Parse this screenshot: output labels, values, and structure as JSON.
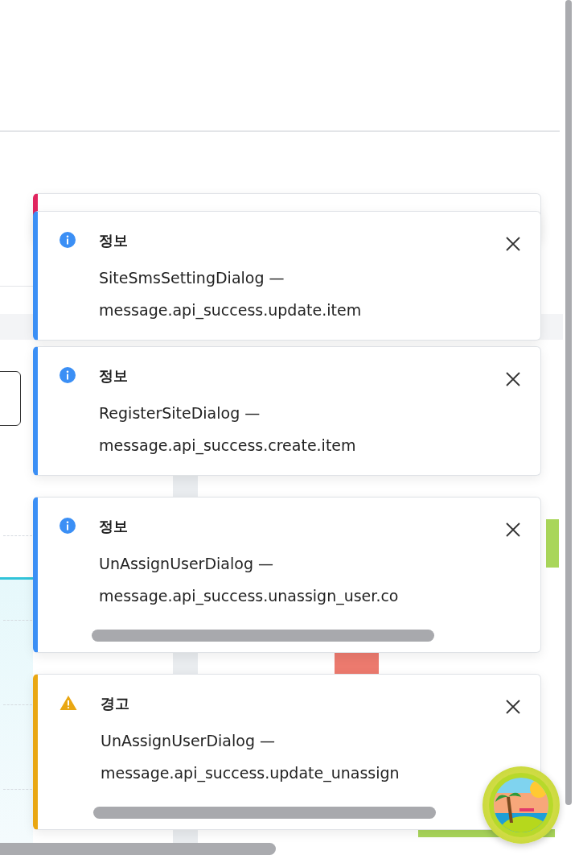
{
  "toasts": [
    {
      "kind": "error"
    },
    {
      "kind": "info",
      "title": "정보",
      "source": "SiteSmsSettingDialog —",
      "message": "message.api_success.update.item",
      "scrollable": false
    },
    {
      "kind": "info",
      "title": "정보",
      "source": "RegisterSiteDialog —",
      "message": "message.api_success.create.item",
      "scrollable": false
    },
    {
      "kind": "info",
      "title": "정보",
      "source": "UnAssignUserDialog —",
      "message": "message.api_success.unassign_user.co",
      "scrollable": true
    },
    {
      "kind": "warning",
      "title": "경고",
      "source": "UnAssignUserDialog —",
      "message": "message.api_success.update_unassign",
      "scrollable": true
    }
  ]
}
